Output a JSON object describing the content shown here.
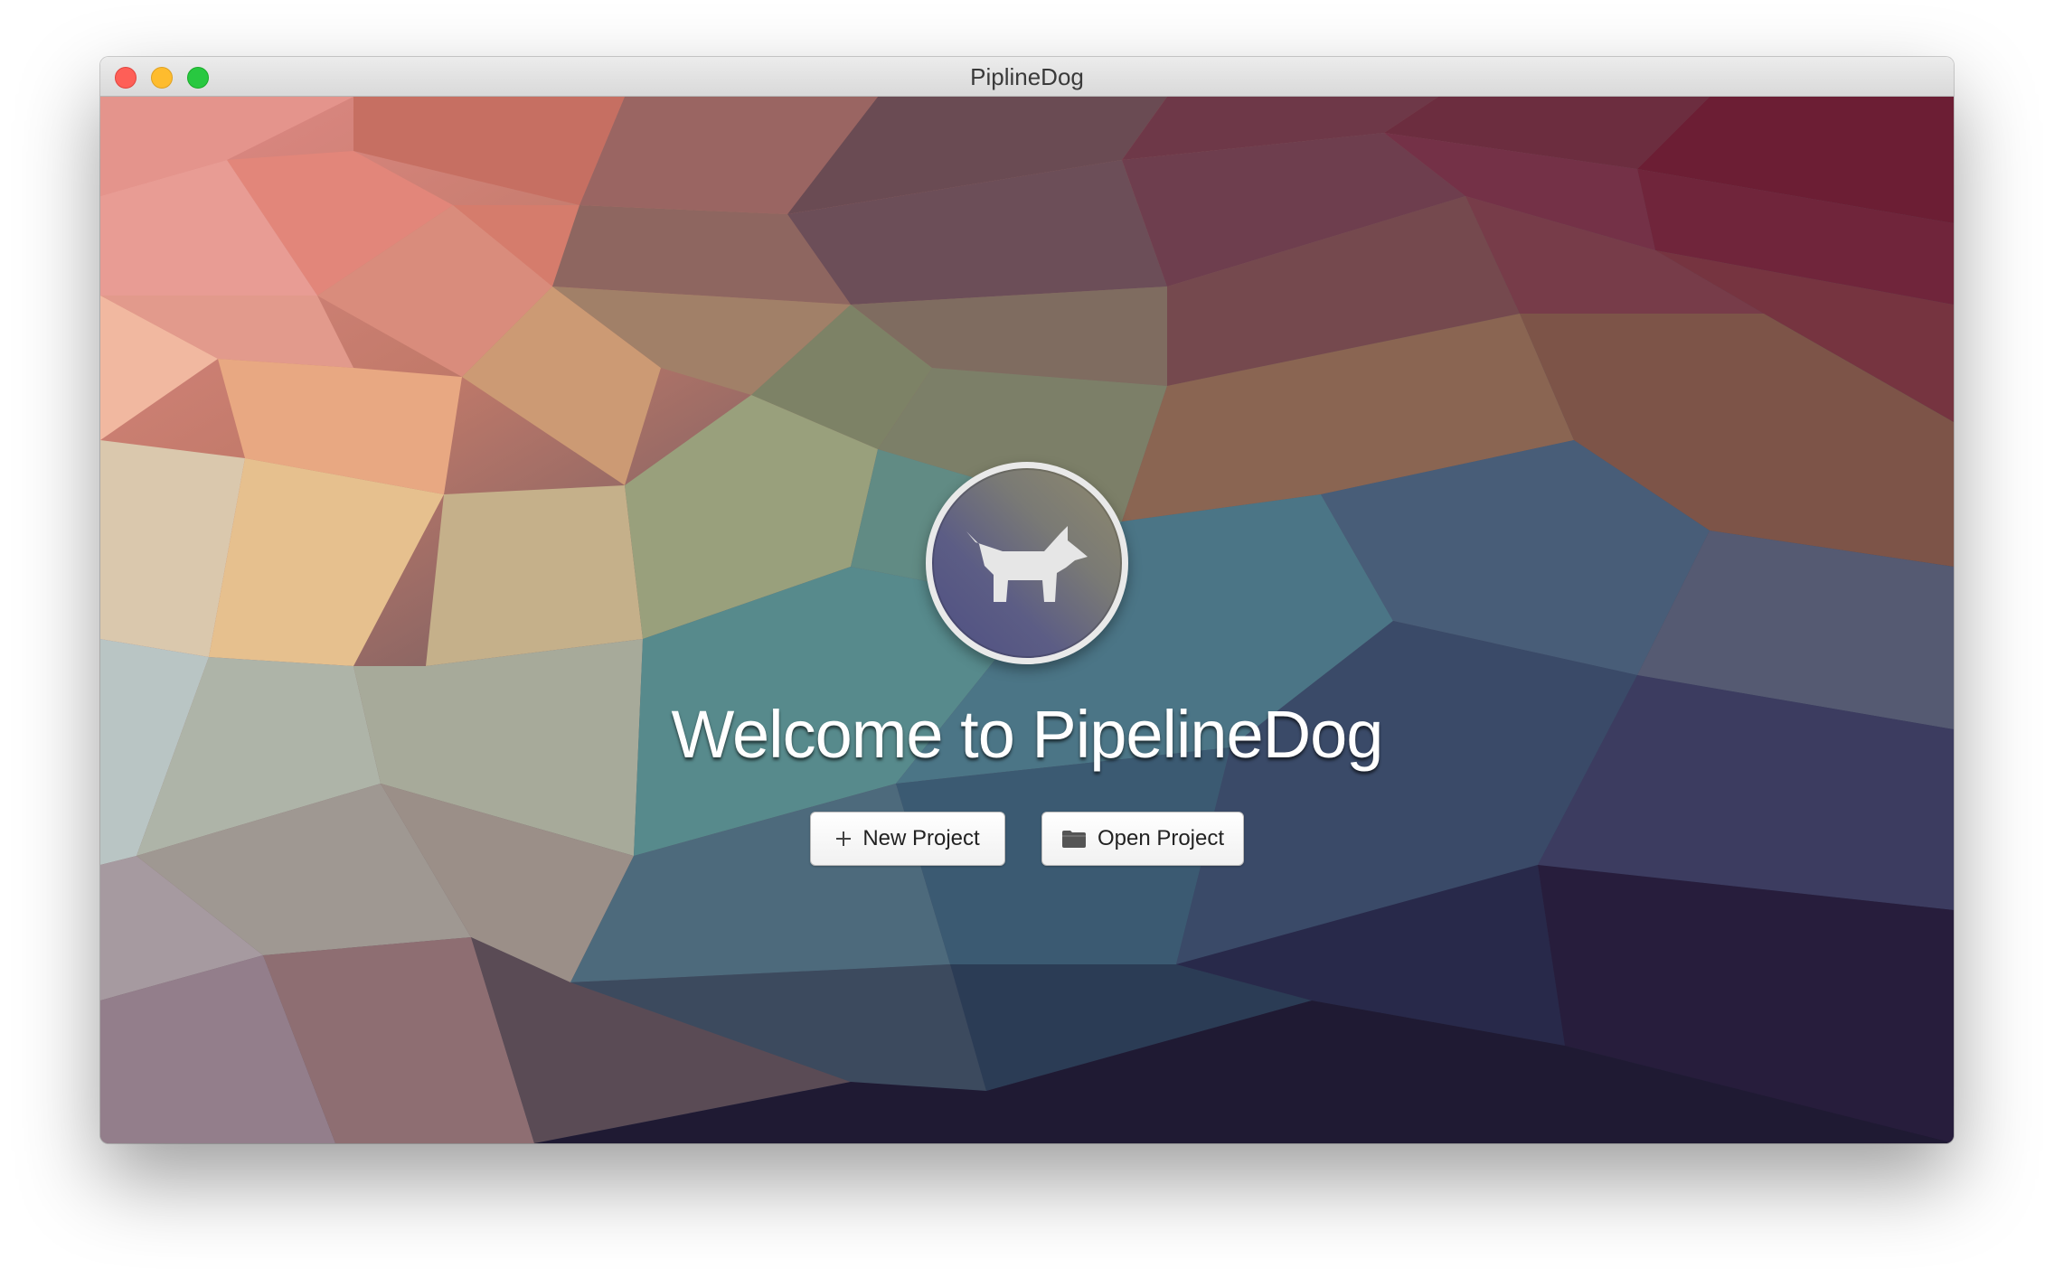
{
  "window": {
    "title": "PiplineDog"
  },
  "welcome": {
    "heading": "Welcome to PipelineDog",
    "logo_icon": "dog-icon"
  },
  "actions": {
    "new_project": {
      "label": "New Project",
      "icon": "plus-icon"
    },
    "open_project": {
      "label": "Open Project",
      "icon": "folder-icon"
    }
  },
  "colors": {
    "close": "#fe5f57",
    "minimize": "#febc2e",
    "zoom": "#28c840"
  }
}
